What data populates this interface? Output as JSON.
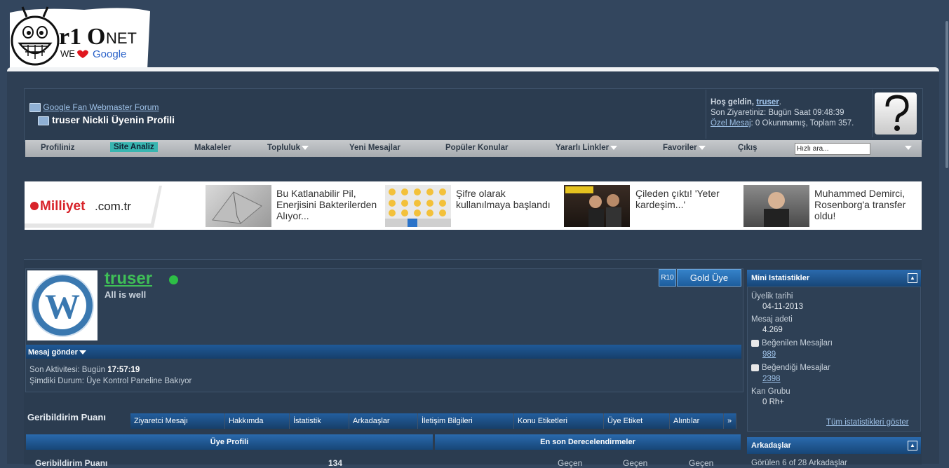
{
  "logo": {
    "brand": "r10NET",
    "tagline_we": "WE",
    "tagline_google": "Google"
  },
  "breadcrumb": {
    "home_link": "Google Fan Webmaster Forum",
    "page_title": "truser Nickli Üyenin Profili"
  },
  "welcome": {
    "greeting": "Hoş geldin,",
    "username": "truser",
    "last_visit": "Son Ziyaretiniz: Bugün Saat 09:48:39",
    "pm_link": "Özel Mesaj",
    "pm_status": ": 0 Okunmamış, Toplam 357."
  },
  "menu": {
    "items": [
      {
        "label": "Profiliniz"
      },
      {
        "label": "Site Analiz"
      },
      {
        "label": "Makaleler"
      },
      {
        "label": "Topluluk"
      },
      {
        "label": "Yeni Mesajlar"
      },
      {
        "label": "Popüler Konular"
      },
      {
        "label": "Yararlı Linkler"
      },
      {
        "label": "Favoriler"
      },
      {
        "label": "Çıkış"
      }
    ],
    "search_value": "Hızlı ara..."
  },
  "ads": {
    "source_brand": "Milliyet",
    "source_domain": ".com.tr",
    "items": [
      {
        "text": "Bu Katlanabilir Pil, Enerjisini Bakterilerden Alıyor..."
      },
      {
        "text": "Şifre olarak kullanılmaya başlandı"
      },
      {
        "text": "Çileden çıktı! 'Yeter kardeşim...'"
      },
      {
        "text": "Muhammed Demirci, Rosenborg'a transfer oldu!"
      }
    ]
  },
  "profile": {
    "username": "truser",
    "user_title": "All is well",
    "badge_r10": "R10",
    "badge_rank": "Gold Üye",
    "message_button": "Mesaj gönder",
    "last_activity_label": "Son Aktivitesi: Bugün",
    "last_activity_time": "17:57:19",
    "current_status": "Şimdiki Durum: Üye Kontrol Paneline Bakıyor"
  },
  "feedback": {
    "title": "Geribildirim Puanı",
    "tabs": [
      {
        "label": "Ziyaretci Mesajı"
      },
      {
        "label": "Hakkımda"
      },
      {
        "label": "İstatistik"
      },
      {
        "label": "Arkadaşlar"
      },
      {
        "label": "İletişim Bilgileri"
      },
      {
        "label": "Konu Etiketleri"
      },
      {
        "label": "Üye Etiket"
      },
      {
        "label": "Alıntılar"
      },
      {
        "label": "»"
      }
    ]
  },
  "columns": {
    "left_header": "Üye Profili",
    "right_header": "En son Derecelendirmeler",
    "left_row_label": "Geribildirim Puanı",
    "left_row_value": "134",
    "right_cols": [
      "Geçen",
      "Geçen",
      "Geçen"
    ]
  },
  "sidebar": {
    "mini_stats_title": "Mini Istatistikler",
    "join_label": "Üyelik tarihi",
    "join_value": "04-11-2013",
    "posts_label": "Mesaj adeti",
    "posts_value": "4.269",
    "liked_label": "Beğenilen Mesajları",
    "liked_value": "989",
    "likes_given_label": "Beğendiği Mesajlar",
    "likes_given_value": "2398",
    "karma_label": "Kan Grubu",
    "karma_value": "0 Rh+",
    "all_stats_link": "Tüm istatistikleri göster",
    "friends_title": "Arkadaşlar",
    "friends_text": "Görülen 6 of 28 Arkadaşlar"
  },
  "colors": {
    "page_bg": "#33465e",
    "accent_blue": "#1f5a98",
    "online_green": "#2dbf46",
    "username_green": "#3fbf57",
    "active_menu": "#38b5b0"
  }
}
